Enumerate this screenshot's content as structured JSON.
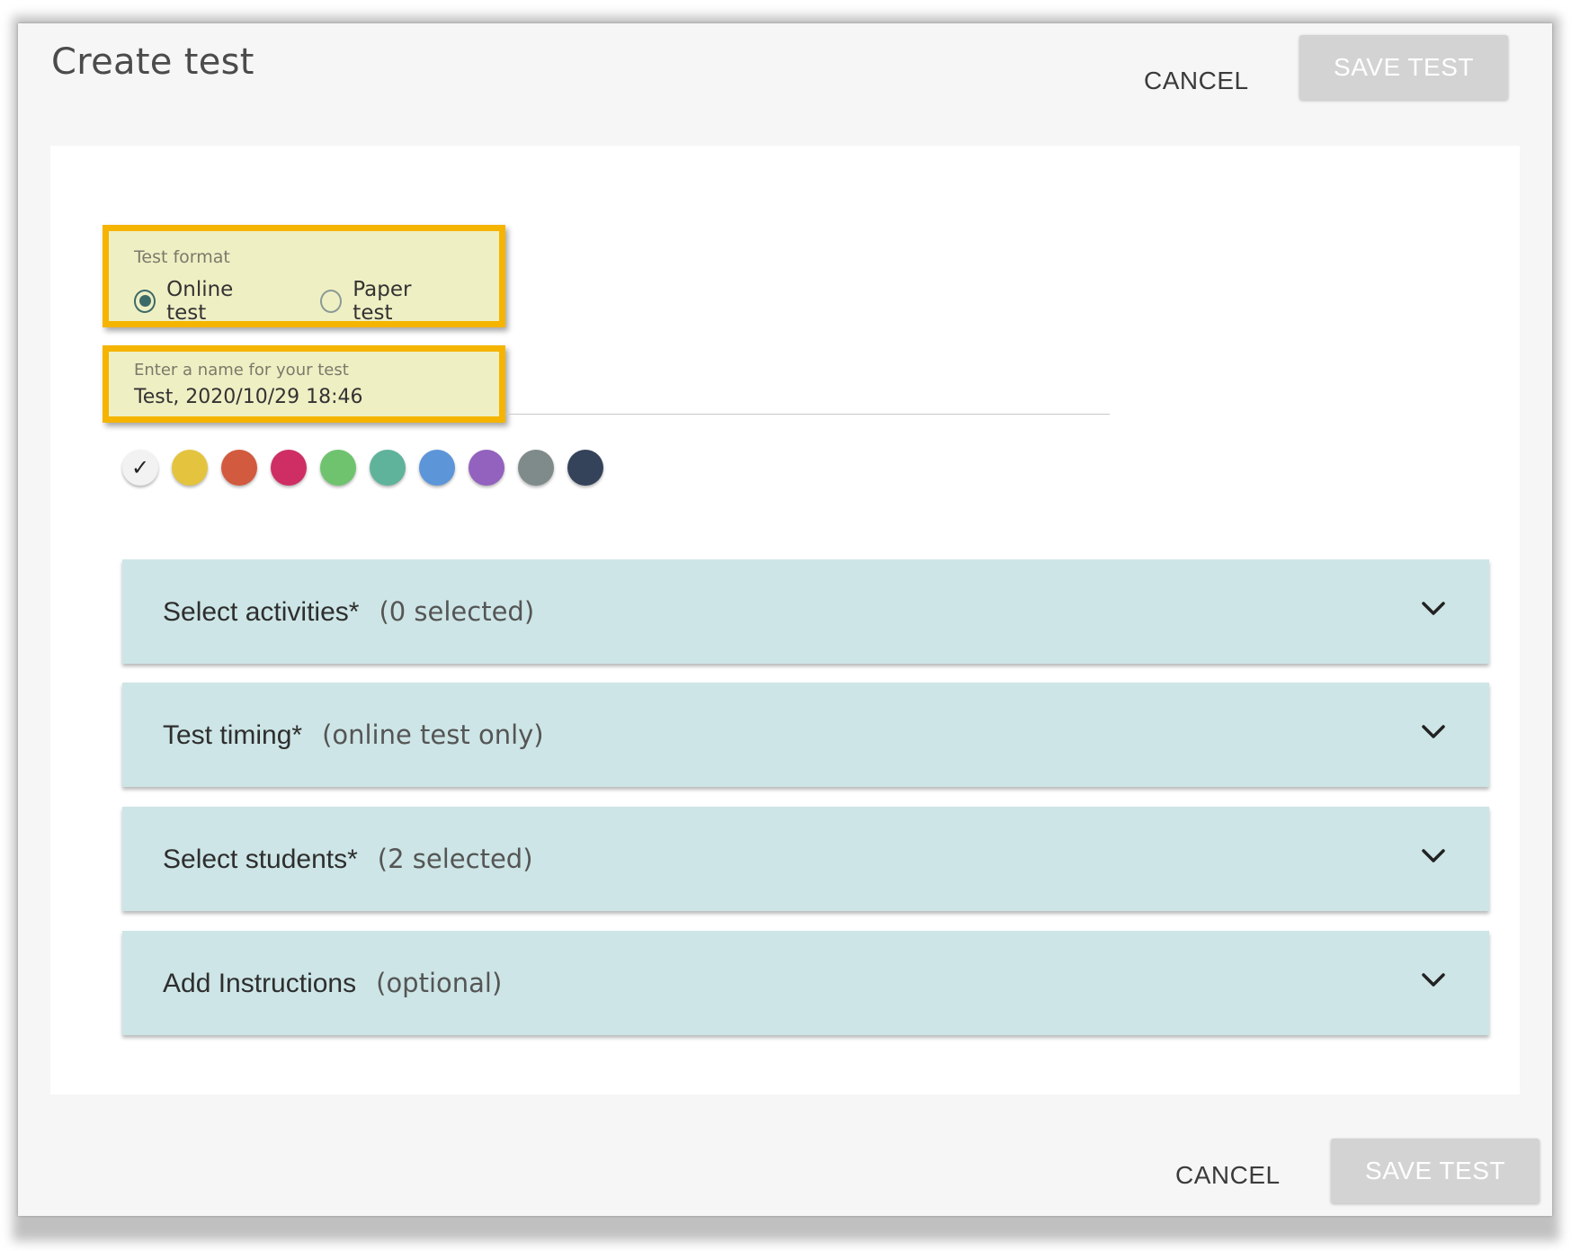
{
  "dialog": {
    "title": "Create test",
    "cancel_label": "CANCEL",
    "save_label": "SAVE TEST"
  },
  "test_format": {
    "label": "Test format",
    "options": [
      "Online test",
      "Paper test"
    ],
    "selected": "Online test"
  },
  "test_name": {
    "label": "Enter a name for your test",
    "value": "Test, 2020/10/29 18:46"
  },
  "colors": {
    "selected_index": 0,
    "swatches": [
      "#f2f2f2",
      "#e4c43f",
      "#d25a3f",
      "#cf2e65",
      "#6fc36f",
      "#5fb39a",
      "#5c95d8",
      "#9361be",
      "#7f8a8a",
      "#34435a"
    ],
    "highlight": "#f5b400",
    "accordion_bg": "#cde5e6"
  },
  "sections": [
    {
      "title": "Select activities*",
      "subtitle": "(0 selected)"
    },
    {
      "title": "Test timing*",
      "subtitle": "(online test only)"
    },
    {
      "title": "Select students*",
      "subtitle": "(2 selected)"
    },
    {
      "title": "Add Instructions",
      "subtitle": "(optional)"
    }
  ],
  "icons": {
    "swatch_selected": "check-icon",
    "section_toggle": "chevron-down-icon"
  }
}
